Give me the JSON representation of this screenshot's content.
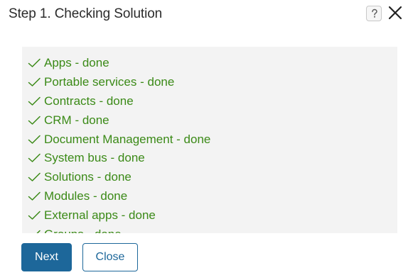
{
  "dialog": {
    "title": "Step 1. Checking Solution",
    "help_icon": "question-mark-icon",
    "close_icon": "close-icon"
  },
  "log": {
    "items": [
      "Apps - done",
      "Portable services - done",
      "Contracts - done",
      "CRM - done",
      "Document Management - done",
      "System bus - done",
      "Solutions - done",
      "Modules - done",
      "External apps - done",
      "Groups - done"
    ],
    "status_icon": "check-icon",
    "status_color": "#3b8a17"
  },
  "buttons": {
    "next_label": "Next",
    "close_label": "Close",
    "primary_color": "#1d679a"
  }
}
